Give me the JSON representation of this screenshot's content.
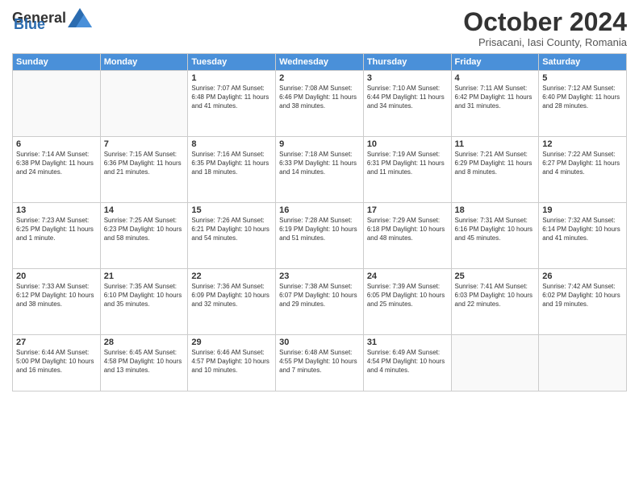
{
  "header": {
    "logo_general": "General",
    "logo_blue": "Blue",
    "month_title": "October 2024",
    "subtitle": "Prisacani, Iasi County, Romania"
  },
  "weekdays": [
    "Sunday",
    "Monday",
    "Tuesday",
    "Wednesday",
    "Thursday",
    "Friday",
    "Saturday"
  ],
  "weeks": [
    [
      {
        "day": "",
        "info": ""
      },
      {
        "day": "",
        "info": ""
      },
      {
        "day": "1",
        "info": "Sunrise: 7:07 AM\nSunset: 6:48 PM\nDaylight: 11 hours and 41 minutes."
      },
      {
        "day": "2",
        "info": "Sunrise: 7:08 AM\nSunset: 6:46 PM\nDaylight: 11 hours and 38 minutes."
      },
      {
        "day": "3",
        "info": "Sunrise: 7:10 AM\nSunset: 6:44 PM\nDaylight: 11 hours and 34 minutes."
      },
      {
        "day": "4",
        "info": "Sunrise: 7:11 AM\nSunset: 6:42 PM\nDaylight: 11 hours and 31 minutes."
      },
      {
        "day": "5",
        "info": "Sunrise: 7:12 AM\nSunset: 6:40 PM\nDaylight: 11 hours and 28 minutes."
      }
    ],
    [
      {
        "day": "6",
        "info": "Sunrise: 7:14 AM\nSunset: 6:38 PM\nDaylight: 11 hours and 24 minutes."
      },
      {
        "day": "7",
        "info": "Sunrise: 7:15 AM\nSunset: 6:36 PM\nDaylight: 11 hours and 21 minutes."
      },
      {
        "day": "8",
        "info": "Sunrise: 7:16 AM\nSunset: 6:35 PM\nDaylight: 11 hours and 18 minutes."
      },
      {
        "day": "9",
        "info": "Sunrise: 7:18 AM\nSunset: 6:33 PM\nDaylight: 11 hours and 14 minutes."
      },
      {
        "day": "10",
        "info": "Sunrise: 7:19 AM\nSunset: 6:31 PM\nDaylight: 11 hours and 11 minutes."
      },
      {
        "day": "11",
        "info": "Sunrise: 7:21 AM\nSunset: 6:29 PM\nDaylight: 11 hours and 8 minutes."
      },
      {
        "day": "12",
        "info": "Sunrise: 7:22 AM\nSunset: 6:27 PM\nDaylight: 11 hours and 4 minutes."
      }
    ],
    [
      {
        "day": "13",
        "info": "Sunrise: 7:23 AM\nSunset: 6:25 PM\nDaylight: 11 hours and 1 minute."
      },
      {
        "day": "14",
        "info": "Sunrise: 7:25 AM\nSunset: 6:23 PM\nDaylight: 10 hours and 58 minutes."
      },
      {
        "day": "15",
        "info": "Sunrise: 7:26 AM\nSunset: 6:21 PM\nDaylight: 10 hours and 54 minutes."
      },
      {
        "day": "16",
        "info": "Sunrise: 7:28 AM\nSunset: 6:19 PM\nDaylight: 10 hours and 51 minutes."
      },
      {
        "day": "17",
        "info": "Sunrise: 7:29 AM\nSunset: 6:18 PM\nDaylight: 10 hours and 48 minutes."
      },
      {
        "day": "18",
        "info": "Sunrise: 7:31 AM\nSunset: 6:16 PM\nDaylight: 10 hours and 45 minutes."
      },
      {
        "day": "19",
        "info": "Sunrise: 7:32 AM\nSunset: 6:14 PM\nDaylight: 10 hours and 41 minutes."
      }
    ],
    [
      {
        "day": "20",
        "info": "Sunrise: 7:33 AM\nSunset: 6:12 PM\nDaylight: 10 hours and 38 minutes."
      },
      {
        "day": "21",
        "info": "Sunrise: 7:35 AM\nSunset: 6:10 PM\nDaylight: 10 hours and 35 minutes."
      },
      {
        "day": "22",
        "info": "Sunrise: 7:36 AM\nSunset: 6:09 PM\nDaylight: 10 hours and 32 minutes."
      },
      {
        "day": "23",
        "info": "Sunrise: 7:38 AM\nSunset: 6:07 PM\nDaylight: 10 hours and 29 minutes."
      },
      {
        "day": "24",
        "info": "Sunrise: 7:39 AM\nSunset: 6:05 PM\nDaylight: 10 hours and 25 minutes."
      },
      {
        "day": "25",
        "info": "Sunrise: 7:41 AM\nSunset: 6:03 PM\nDaylight: 10 hours and 22 minutes."
      },
      {
        "day": "26",
        "info": "Sunrise: 7:42 AM\nSunset: 6:02 PM\nDaylight: 10 hours and 19 minutes."
      }
    ],
    [
      {
        "day": "27",
        "info": "Sunrise: 6:44 AM\nSunset: 5:00 PM\nDaylight: 10 hours and 16 minutes."
      },
      {
        "day": "28",
        "info": "Sunrise: 6:45 AM\nSunset: 4:58 PM\nDaylight: 10 hours and 13 minutes."
      },
      {
        "day": "29",
        "info": "Sunrise: 6:46 AM\nSunset: 4:57 PM\nDaylight: 10 hours and 10 minutes."
      },
      {
        "day": "30",
        "info": "Sunrise: 6:48 AM\nSunset: 4:55 PM\nDaylight: 10 hours and 7 minutes."
      },
      {
        "day": "31",
        "info": "Sunrise: 6:49 AM\nSunset: 4:54 PM\nDaylight: 10 hours and 4 minutes."
      },
      {
        "day": "",
        "info": ""
      },
      {
        "day": "",
        "info": ""
      }
    ]
  ]
}
